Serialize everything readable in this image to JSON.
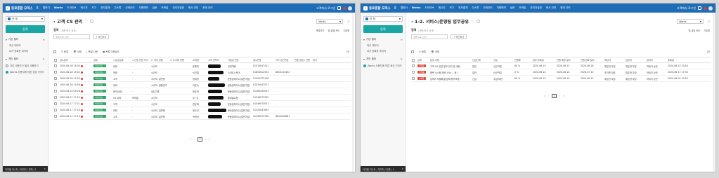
{
  "common": {
    "brand": "동료종합 오피스",
    "nav": [
      "",
      "홈",
      "캘린더",
      "Works",
      "드라이브",
      "메시지",
      "보고",
      "전자결재",
      "주소록",
      "근태관리",
      "자원예약",
      "설문",
      "모바일",
      "관리자설정",
      "회사 관리",
      "회계 관리"
    ],
    "nav_selected": 3,
    "user_name": "고객에서 로그인",
    "space_select": "전 체",
    "new_button": "등록",
    "filter_section": "기본 필터",
    "filter_items": [
      "최근 데이터",
      "내가 등록한 데이터"
    ],
    "share_section": "개인 필터",
    "share_items": [
      "다른 사용자가 필터 사용하기",
      "Works 사용자에 따른 생성 가이드"
    ],
    "taskbar_text": "아이템 리스트 / 데이터 / 전체 / 1",
    "taskbar_close": "×",
    "works_select": "Works",
    "keyword_label": "검색",
    "keyword_note": "(제목/조건 검색)",
    "filter_placeholder": "제목으로 검색",
    "filter_add": "+ 조건추가",
    "toolbar": {
      "new": "등록",
      "delete": "삭제",
      "export": "엑셀 다운",
      "settings": "목록 다운로드",
      "page_size": "20"
    }
  },
  "left": {
    "title": "고객 CS 관리",
    "kw_right": [
      "목록보기",
      "앱 설정 관리",
      "기본형"
    ],
    "columns": [
      "",
      "접수일자",
      "",
      "상태",
      "1.접수분류",
      "1 신청 연동 이사",
      "2. 처리 방법",
      "3. 주거래 진행",
      "고객명",
      "고객 연락처",
      "가입된 번호",
      "접수번호",
      "카드 승인번호",
      "연동 방법 / 진행",
      "비고"
    ],
    "rows": [
      [
        "2020-06-28 15:05",
        "처리/완료 ✓",
        "전화",
        "-",
        "소규모",
        "문혜미",
        "인재역량",
        "01515047411",
        "-"
      ],
      [
        "2020-06-28 15:02",
        "처리/완료 ✓",
        "전화",
        "-",
        "소규모",
        "신건철",
        "스마트스토어",
        "01854612934",
        "8610215452"
      ],
      [
        "2020-06-18 14:55",
        "처리/완료 ✓",
        "고객",
        "-",
        "소규모, 일반형",
        "정재영",
        "문동완파이니(일반가업)",
        "01505375106",
        "-"
      ],
      [
        "2020-06-28 14:56",
        "처리/완료 ✓",
        "전화",
        "-",
        "소규모, 환불연기",
        "이은숙",
        "문동완파이니(일반가업)",
        "01525047571",
        "-"
      ],
      [
        "2020-06-19 09:28",
        "처리/완료 ✓",
        "문의/상담",
        "-",
        "상담기록",
        "한은희",
        "문동완파이니(일반가업)",
        "01285032057",
        "-"
      ],
      [
        "2020-06-17 17:22",
        "처리/완료 ✓",
        "CS 요청",
        "모바일",
        "소규모",
        "우~다",
        "롯데홈쇼핑",
        "01546072295",
        "-"
      ],
      [
        "2020-06-17 17:21",
        "처리/완료 ✓",
        "고객",
        "-",
        "소규모",
        "한은희",
        "문동완파이니(일반가업)",
        "01546073031",
        "-"
      ],
      [
        "2020-06-17 17:20",
        "처리/완료 ✓",
        "전화",
        "-",
        "소규모, 일반형",
        "정오건",
        "문동완파이니(일반가업)",
        "01525047643",
        "-"
      ],
      [
        "2020-06-17 17:19",
        "처리/완료 ✓",
        "고객",
        "-",
        "소규모, 일반형",
        "박권현",
        "문동완파이니(일반가업)",
        "01546073766",
        "8610058681"
      ]
    ],
    "pager": [
      "«",
      "‹",
      "1",
      "›",
      "»"
    ]
  },
  "right": {
    "title": "1-2. 서비스/운영팀 업무공유",
    "kw_right": [
      "앱 설정 관리",
      "기본형"
    ],
    "columns": [
      "",
      "상태",
      "업무 사항",
      "진급단계",
      "구분",
      "진행률",
      "업무 등록일",
      "진행 예정 일자",
      "진행 완료 일자",
      "책임자",
      "담당자",
      "참여자",
      "등록일"
    ],
    "rows": [
      [
        "고객 CS 관련 정보 관리 및 세팅",
        "일반",
        "신규작업",
        "60 %",
        "2020-06-15",
        "2020-06-12",
        "2020-06-18",
        "채은한 부장",
        "채은한 부장",
        "하세이 상관",
        "2020-06-15 10:50"
      ],
      [
        "플랫 시스템 정비 (Fla ... 등)",
        "일반",
        "신규작업",
        "0 %",
        "2020-06-24",
        "2020-06-24",
        "2020-07-10",
        "조지엔 대표",
        "채은한 부장",
        "하세이 상관",
        "2020-06-17 17:30"
      ],
      [
        "온체즈 모듈화일(정보/평가보증)",
        "긴급",
        "수정/보완",
        "60 %",
        "2020-06-10",
        "2020-06-10",
        "2020-06-12",
        "채은한 부장",
        "채은한 부장",
        "하세이 상관",
        "2020-06-04 10:53"
      ]
    ],
    "status_label": "진행중",
    "pager": [
      "«",
      "‹",
      "1",
      "›",
      "»"
    ]
  }
}
